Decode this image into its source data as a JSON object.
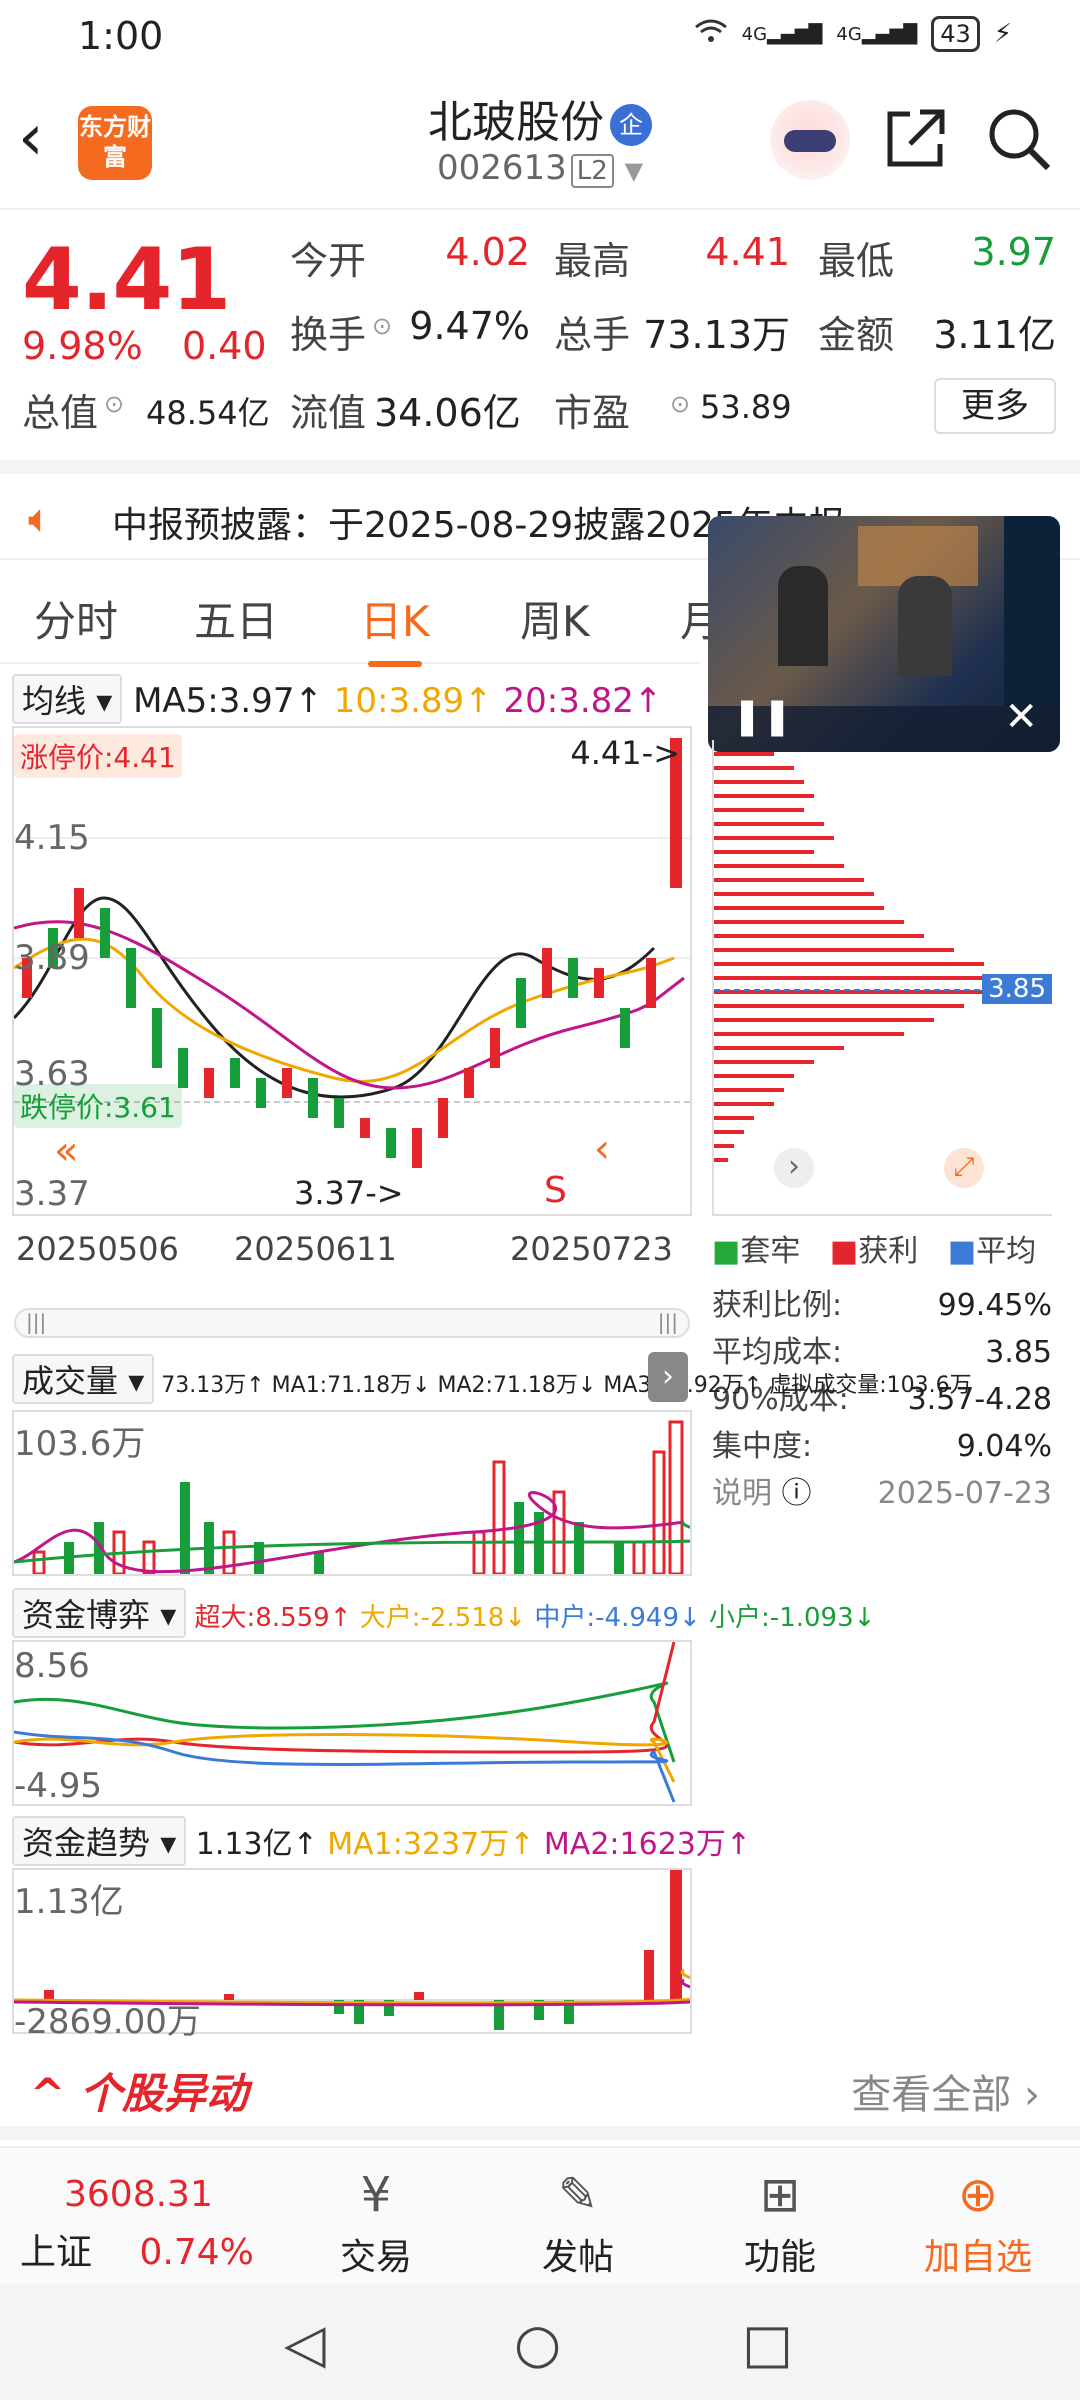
{
  "status": {
    "time": "1:00",
    "signal1": "4G",
    "signal2": "4G",
    "battery": "43"
  },
  "header": {
    "logo_text": "东方财富",
    "title": "北玻股份",
    "badge": "企",
    "code": "002613",
    "level": "L2"
  },
  "quote": {
    "price": "4.41",
    "change_pct": "9.98%",
    "change_amt": "0.40",
    "rows": [
      {
        "l1": "今开",
        "v1": "4.02",
        "l2": "最高",
        "v2": "4.41",
        "l3": "最低",
        "v3": "3.97"
      },
      {
        "l1": "换手",
        "v1": "9.47%",
        "l2": "总手",
        "v2": "73.13万",
        "l3": "金额",
        "v3": "3.11亿"
      },
      {
        "l1": "总值",
        "v1": "48.54亿",
        "l2": "流值",
        "v2": "34.06亿",
        "l3": "市盈",
        "v3": "53.89"
      }
    ],
    "more": "更多"
  },
  "notice": {
    "text": "中报预披露：于2025-08-29披露2025年中报"
  },
  "tabs": [
    "分时",
    "五日",
    "日K",
    "周K",
    "月"
  ],
  "ma_legend": {
    "select": "均线",
    "ma5": "MA5:3.97↑",
    "ma10": "10:3.89↑",
    "ma20": "20:3.82↑"
  },
  "kchart": {
    "limit_up": "涨停价:4.41",
    "limit_down": "跌停价:3.61",
    "high_tag": "4.41->",
    "low_tag": "3.37->",
    "y_labels": [
      "4.15",
      "3.89",
      "3.63",
      "3.37"
    ],
    "dates": [
      "20250506",
      "20250611",
      "20250723"
    ],
    "sell_mark": "S",
    "cost_price": "3.85"
  },
  "volume": {
    "select": "成交量",
    "legend": "73.13万↑ MA1:71.18万↓ MA2:71.18万↓ MA3:36.92万↑ 虚拟成交量:103.6万",
    "ymax": "103.6万"
  },
  "fund_game": {
    "select": "资金博弈",
    "super": "超大:8.559↑",
    "large": "大户:-2.518↓",
    "mid": "中户:-4.949↓",
    "small": "小户:-1.093↓",
    "ymax": "8.56",
    "ymin": "-4.95"
  },
  "fund_trend": {
    "select": "资金趋势",
    "val": "1.13亿↑",
    "ma1": "MA1:3237万↑",
    "ma2": "MA2:1623万↑",
    "ymax": "1.13亿",
    "ymin": "-2869.00万"
  },
  "chip": {
    "legend": [
      {
        "label": "套牢",
        "color": "#23a93a"
      },
      {
        "label": "获利",
        "color": "#e4262c"
      },
      {
        "label": "平均",
        "color": "#3b7bd6"
      }
    ],
    "rows": [
      {
        "k": "获利比例:",
        "v": "99.45%"
      },
      {
        "k": "平均成本:",
        "v": "3.85"
      },
      {
        "k": "90%成本:",
        "v": "3.57-4.28"
      },
      {
        "k": "集中度:",
        "v": "9.04%"
      },
      {
        "k": "说明",
        "v": "2025-07-23"
      }
    ]
  },
  "alerts": {
    "title": "个股异动",
    "view_all": "查看全部"
  },
  "bottom": {
    "index_value": "3608.31",
    "index_name": "上证",
    "index_chg": "0.74%",
    "items": [
      "交易",
      "发帖",
      "功能",
      "加自选"
    ]
  }
}
